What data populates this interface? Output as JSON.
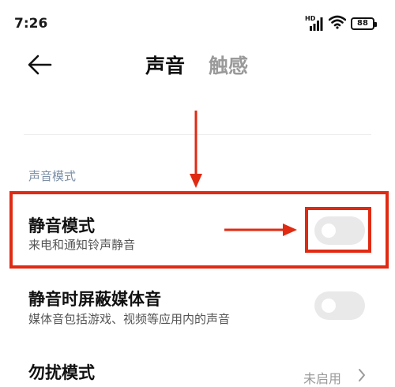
{
  "status_bar": {
    "time": "7:26",
    "network_label": "HD",
    "battery_level": "88",
    "icons": [
      "hd-signal-icon",
      "wifi-icon",
      "battery-icon"
    ]
  },
  "header": {
    "back_icon": "back-arrow-icon",
    "tabs": [
      {
        "label": "声音",
        "active": true
      },
      {
        "label": "触感",
        "active": false
      }
    ]
  },
  "sections": [
    {
      "title": "声音模式",
      "items": [
        {
          "title": "静音模式",
          "subtitle": "来电和通知铃声静音",
          "control": "toggle",
          "on": false
        },
        {
          "title": "静音时屏蔽媒体音",
          "subtitle": "媒体音包括游戏、视频等应用内的声音",
          "control": "toggle",
          "on": false
        },
        {
          "title": "勿扰模式",
          "value": "未启用",
          "control": "chevron"
        }
      ]
    }
  ],
  "annotations": {
    "color": "#e02a12",
    "arrows": [
      "arrow-down-to-silent-mode",
      "arrow-right-to-toggle"
    ]
  },
  "colors": {
    "section_title": "#7d8fa6",
    "toggle_off": "#e9e9e9",
    "annotation": "#e02a12"
  }
}
